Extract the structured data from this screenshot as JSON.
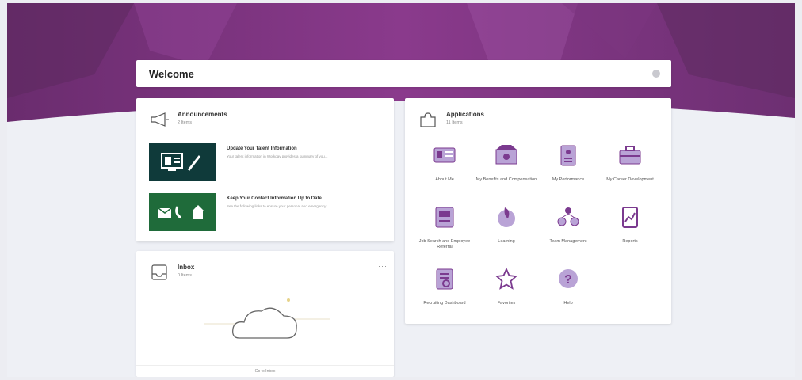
{
  "welcome": {
    "title": "Welcome"
  },
  "announcements": {
    "title": "Announcements",
    "count": "2 Items",
    "items": [
      {
        "title": "Update Your Talent Information",
        "desc": "Your talent information in Workday provides a summary of you..."
      },
      {
        "title": "Keep Your Contact Information Up to Date",
        "desc": "See the following links to ensure your personal and emergency..."
      }
    ]
  },
  "applications": {
    "title": "Applications",
    "count": "11 Items",
    "items": [
      {
        "label": "About Me",
        "icon": "about-me-icon"
      },
      {
        "label": "My Benefits and Compensation",
        "icon": "benefits-icon"
      },
      {
        "label": "My Performance",
        "icon": "performance-icon"
      },
      {
        "label": "My Career Development",
        "icon": "career-icon"
      },
      {
        "label": "Job Search and Employee Referral",
        "icon": "job-search-icon"
      },
      {
        "label": "Learning",
        "icon": "learning-icon"
      },
      {
        "label": "Team Management",
        "icon": "team-icon"
      },
      {
        "label": "Reports",
        "icon": "reports-icon"
      },
      {
        "label": "Recruiting Dashboard",
        "icon": "recruiting-icon"
      },
      {
        "label": "Favorites",
        "icon": "favorites-icon"
      },
      {
        "label": "Help",
        "icon": "help-icon"
      }
    ]
  },
  "inbox": {
    "title": "Inbox",
    "count": "0 Items",
    "more": "···",
    "goto": "Go to Inbox"
  },
  "colors": {
    "accent": "#7b3a8f",
    "ann_bg": "#0f3a3a",
    "ann_bg2": "#1f6b3a",
    "purple_light": "#b9a3d6"
  }
}
